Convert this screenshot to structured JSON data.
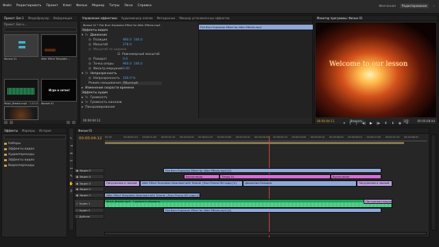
{
  "menu": [
    "Файл",
    "Редактировать",
    "Проект",
    "Клип",
    "Фильм",
    "Маркер",
    "Титры",
    "Окно",
    "Справка"
  ],
  "workspace": {
    "label": "Фонтанная",
    "selected": "Редактирование"
  },
  "project": {
    "title": "Проект: Без н...",
    "tabs": [
      "Проект: Без 1",
      "Медиабраузер",
      "Информация"
    ],
    "items": [
      {
        "name": "Фильм 01",
        "meta": ""
      },
      {
        "name": "After Effect Template ...",
        "meta": ""
      },
      {
        "name": "Фильм 01",
        "meta": ""
      },
      {
        "name": "Music_Breath.mp3",
        "meta": "2:35:00"
      },
      {
        "name": "Фильм 01",
        "meta": ""
      },
      {
        "name": "Fire Burn Explosion Eff...",
        "meta": ""
      }
    ],
    "thumb_overlay": "Игра в сетке!"
  },
  "effect_controls": {
    "tabs": [
      "Управление эффектами",
      "Аудиомикшер клипов",
      "Метаданные",
      "Микшер установленных эффектов"
    ],
    "clip_label": "Фильм 01 * Fire Burn Explosion Effect for After Effects.mp4",
    "timeline_clip": "Fire Burn Explosion Effect for After Effects.mp4",
    "section_video": "Эффекты видео",
    "motion": "Движение",
    "position": {
      "label": "Позиция",
      "x": "960.0",
      "y": "540.0"
    },
    "scale": {
      "label": "Масштаб",
      "value": "278.0"
    },
    "scale_width": {
      "label": "Масштаб по ширине",
      "value": ""
    },
    "uniform": "Равномерный масштаб",
    "rotation": {
      "label": "Поворот",
      "value": "0.0"
    },
    "anchor": {
      "label": "Точка опоры",
      "x": "960.0",
      "y": "540.0"
    },
    "flicker": {
      "label": "Фильтр мерцания",
      "value": "0.00"
    },
    "opacity_section": "Непрозрачность",
    "opacity": {
      "label": "Непрозрачность",
      "value": "100.0 %"
    },
    "blend": {
      "label": "Режим смешивания",
      "value": "Обычный"
    },
    "time_remap": "Изменение скорости времени",
    "section_audio": "Эффекты аудио",
    "volume": "Громкость",
    "channel_volume": "Громкость каналов",
    "panner": "Панорамирование",
    "timecode": "00:00:04:12"
  },
  "program": {
    "title": "Монитор программы: Фильм 01",
    "overlay_text": "Welcome to our lesson",
    "timecode_left": "00:00:04:11",
    "zoom": "Вписать",
    "quality": "1/2",
    "timecode_right": "00:00:08:04"
  },
  "effects_panel": {
    "tabs": [
      "Эффекты",
      "Маркеры",
      "История"
    ],
    "items": [
      "Наборы",
      "Эффекты видео",
      "Аудиопереходы",
      "Эффекты видео",
      "Видеопереходы"
    ]
  },
  "timeline": {
    "tab": "Фильм 01",
    "timecode": "00:00:04:12",
    "ruler": [
      "00:00",
      "00:00:00:15",
      "00:00:01:00",
      "00:00:01:15",
      "00:00:02:00",
      "00:00:02:15",
      "00:00:03:00",
      "00:00:03:15",
      "00:00:04:00",
      "00:00:04:15",
      "00:00:05:00",
      "00:00:05:15",
      "00:00:06:00",
      "00:00:06:15",
      "00:00:07:00",
      "00:00:07:15",
      "00:00:08:00"
    ],
    "playhead_fraction": 0.548,
    "tracks": [
      {
        "name": "Видео 5"
      },
      {
        "name": "Видео 4"
      },
      {
        "name": "Видео 3"
      },
      {
        "name": "Видео 2"
      },
      {
        "name": "Видео 1"
      },
      {
        "name": "Аудио 1"
      },
      {
        "name": "Аудио 2"
      },
      {
        "name": "Дубляж"
      }
    ],
    "clips": {
      "v5": "Fire Burn Explosion Effect for After Effects.mp4 [V]",
      "v4a": "Вытеснение",
      "v4b": "Титры 01",
      "v4c": "Вытеснение",
      "v3a": "Погружение в черный",
      "v3b": "After Effect Templates Download with Tutorial | Burn Promo HD Logo) [V]",
      "v3c": "Движение:Позиция",
      "v3d": "Погружение в черный",
      "v1": "After Effect Templates Download with Tutorial | Burn Promo HD Logo) [V]",
      "a1a": "Music_Breath.mp3",
      "a1b": "Громкость:Уровень",
      "a1c": "Постоянная мощность",
      "a2": "Fire Burn Explosion Effect for After Effects.mp4 [A]"
    }
  },
  "colors": {
    "accent": "#e8a23a",
    "blue": "#5aa0e6",
    "clip_blue": "#8fa8d8",
    "clip_pink": "#d36fd3",
    "clip_green": "#2ecc71"
  }
}
